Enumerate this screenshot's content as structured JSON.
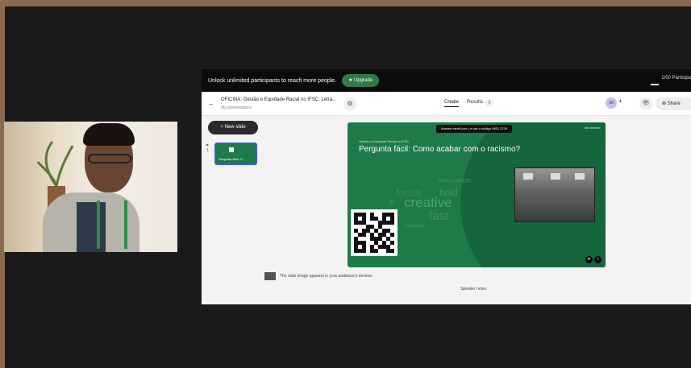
{
  "banner": {
    "text": "Unlock unlimited participants to reach more people.",
    "upgrade_label": "Upgrade",
    "participants": "1/50 Participa"
  },
  "topbar": {
    "back_glyph": "←",
    "title": "OFICINA: Gestão e Equidade Racial no IFSC: Letra...",
    "subtitle": "My presentations",
    "gear_glyph": "⚙",
    "tab_create": "Create",
    "tab_results": "Results",
    "results_count": "0",
    "avatar_text": "90",
    "plus_glyph": "+",
    "eye_glyph": "👁",
    "share_label": "Share"
  },
  "sidebar": {
    "new_slide_label": "+ New slide",
    "slide_number": "1",
    "thumb_label": "Pergunta fácil: C..."
  },
  "slide": {
    "code_text": "Acesse menti.com | e use o código 4951 2729",
    "brand": "Mentimeter",
    "small_title": "Gestão e Equidade Racial no IFSC",
    "question": "Pergunta fácil: Como acabar com o racismo?",
    "words": [
      "innovation",
      "focus",
      "bold",
      "creative",
      "fast",
      "inspiration",
      "fit"
    ]
  },
  "hint": {
    "text": "The slide image appears in your audience's devices"
  },
  "speaker_notes": "Speaker notes",
  "colors": {
    "accent": "#1f7a4a",
    "banner_bg": "#0b0b0b",
    "upgrade": "#2f7a45"
  }
}
